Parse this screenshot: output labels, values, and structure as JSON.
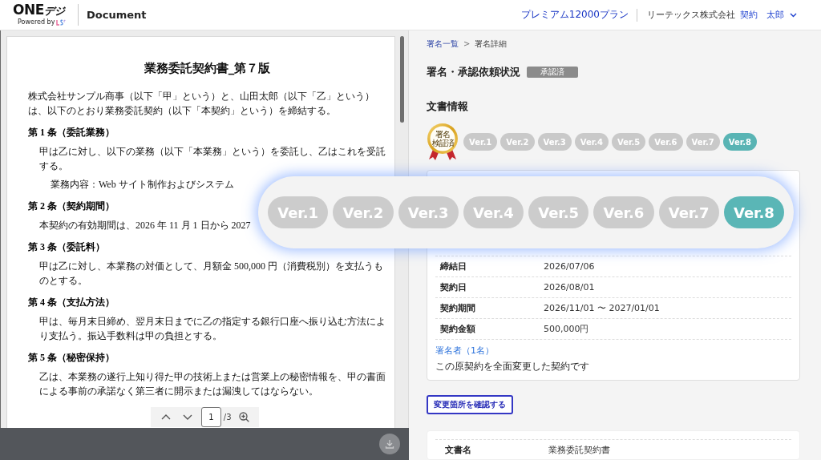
{
  "header": {
    "logo": {
      "main": "ONE",
      "accent": "デジ",
      "tagline": "Powered by"
    },
    "title": "Document",
    "plan_link": "プレミアム12000プラン",
    "company": "リーテックス株式会社",
    "contract_link": "契約",
    "user_menu": "太郎"
  },
  "viewer": {
    "document": {
      "title": "業務委託契約書_第７版",
      "blocks": [
        {
          "kind": "lead",
          "text": "株式会社サンプル商事（以下「甲」という）と、山田太郎（以下「乙」という）は、以下のとおり業務委託契約（以下「本契約」という）を締結する。"
        },
        {
          "kind": "heading",
          "text": "第 1 条（委託業務）"
        },
        {
          "kind": "clause",
          "text": "甲は乙に対し、以下の業務（以下「本業務」という）を委託し、乙はこれを受託する。"
        },
        {
          "kind": "item",
          "text": "業務内容：Web サイト制作およびシステム"
        },
        {
          "kind": "heading",
          "text": "第 2 条（契約期間）"
        },
        {
          "kind": "clause",
          "text": "本契約の有効期間は、2026 年 11 月 1 日から 2027"
        },
        {
          "kind": "heading",
          "text": "第 3 条（委託料）"
        },
        {
          "kind": "clause",
          "text": "甲は乙に対し、本業務の対価として、月額金 500,000 円（消費税別）を支払うものとする。"
        },
        {
          "kind": "heading",
          "text": "第 4 条（支払方法）"
        },
        {
          "kind": "clause",
          "text": "甲は、毎月末日締め、翌月末日までに乙の指定する銀行口座へ振り込む方法により支払う。振込手数料は甲の負担とする。"
        },
        {
          "kind": "heading",
          "text": "第 5 条（秘密保持）"
        },
        {
          "kind": "clause",
          "text": "乙は、本業務の遂行上知り得た甲の技術上または営業上の秘密情報を、甲の書面による事前の承諾なく第三者に開示または漏洩してはならない。"
        }
      ]
    },
    "page_nav": {
      "page": "1",
      "total": "/3"
    }
  },
  "detail": {
    "breadcrumb": [
      {
        "kind": "link",
        "label": "署名一覧"
      },
      {
        "kind": "separator",
        "label": ">"
      },
      {
        "kind": "current",
        "label": "署名詳細"
      }
    ],
    "title": "署名・承認依頼状況",
    "status_badge": "承認済",
    "section_title": "文書情報",
    "seal": {
      "lines": [
        "署名",
        "検証済"
      ]
    },
    "versions": [
      {
        "label": "Ver.1",
        "selected": false
      },
      {
        "label": "Ver.2",
        "selected": false
      },
      {
        "label": "Ver.3",
        "selected": false
      },
      {
        "label": "Ver.4",
        "selected": false
      },
      {
        "label": "Ver.5",
        "selected": false
      },
      {
        "label": "Ver.6",
        "selected": false
      },
      {
        "label": "Ver.7",
        "selected": false
      },
      {
        "label": "Ver.8",
        "selected": true
      }
    ],
    "fields": [
      {
        "label": "締結日",
        "value": "2026/07/06"
      },
      {
        "label": "契約日",
        "value": "2026/08/01"
      },
      {
        "label": "契約期間",
        "value": "2026/11/01 〜 2027/01/01"
      },
      {
        "label": "契約金額",
        "value": "500,000円"
      }
    ],
    "signers_link": "署名者（1名）",
    "note": "この原契約を全面変更した契約です",
    "changes_button": "変更箇所を確認する",
    "next_card": {
      "fields": [
        {
          "label": "文書名",
          "value": "業務委託契約書"
        }
      ]
    }
  },
  "magnifier": {
    "versions": [
      {
        "label": "Ver.1",
        "selected": false
      },
      {
        "label": "Ver.2",
        "selected": false
      },
      {
        "label": "Ver.3",
        "selected": false
      },
      {
        "label": "Ver.4",
        "selected": false
      },
      {
        "label": "Ver.5",
        "selected": false
      },
      {
        "label": "Ver.6",
        "selected": false
      },
      {
        "label": "Ver.7",
        "selected": false
      },
      {
        "label": "Ver.8",
        "selected": true
      }
    ]
  }
}
